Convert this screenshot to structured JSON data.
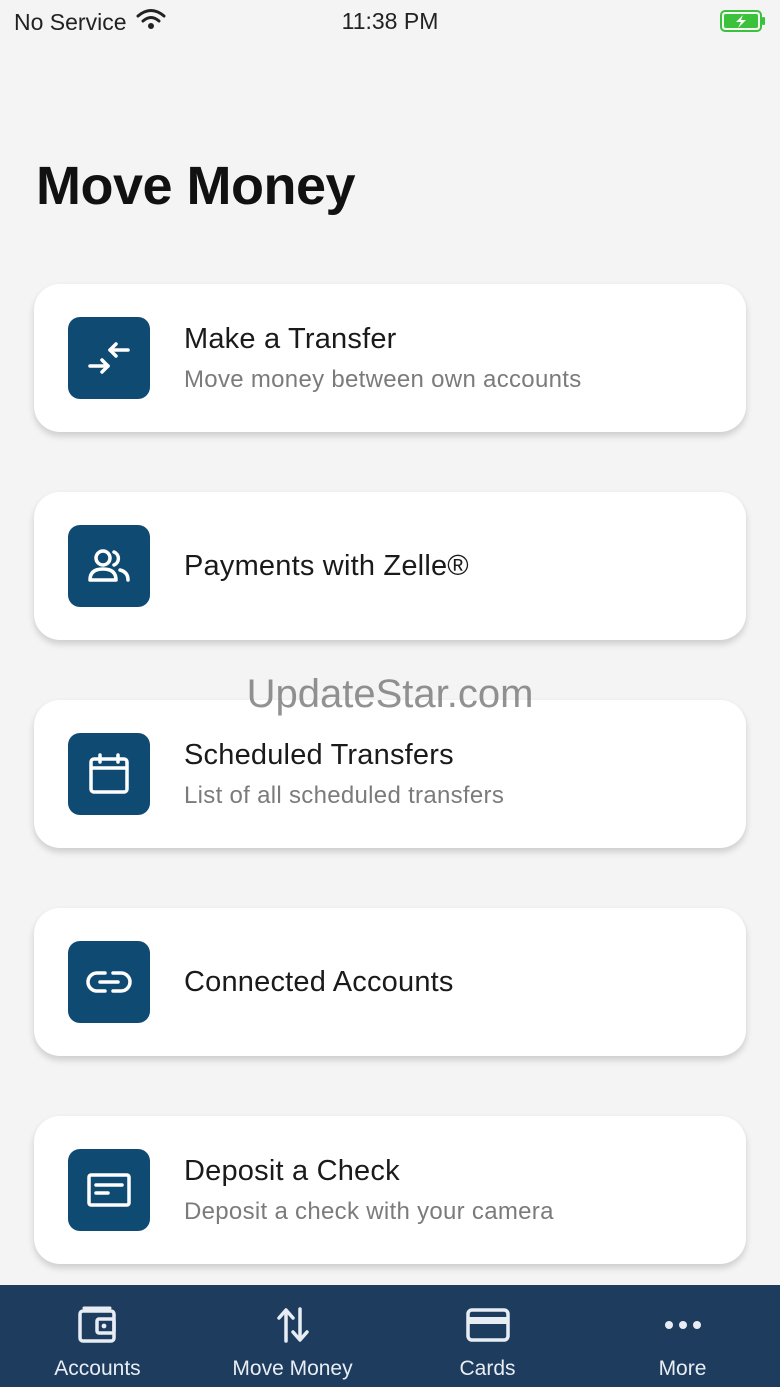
{
  "status_bar": {
    "carrier": "No Service",
    "time": "11:38 PM",
    "battery_color": "#3cc13c"
  },
  "page": {
    "title": "Move Money"
  },
  "colors": {
    "primary": "#0f4a72",
    "tab_bar": "#1d3c5e",
    "background": "#f4f4f4"
  },
  "items": [
    {
      "icon": "transfer-arrows-icon",
      "title": "Make a Transfer",
      "subtitle": "Move money between own accounts"
    },
    {
      "icon": "people-icon",
      "title": "Payments with Zelle®",
      "subtitle": ""
    },
    {
      "icon": "calendar-icon",
      "title": "Scheduled Transfers",
      "subtitle": "List of all scheduled transfers"
    },
    {
      "icon": "link-icon",
      "title": "Connected Accounts",
      "subtitle": ""
    },
    {
      "icon": "check-icon",
      "title": "Deposit a Check",
      "subtitle": "Deposit a check with your camera"
    }
  ],
  "watermark": "UpdateStar.com",
  "tabs": [
    {
      "icon": "wallet-icon",
      "label": "Accounts"
    },
    {
      "icon": "up-down-arrows-icon",
      "label": "Move Money"
    },
    {
      "icon": "card-icon",
      "label": "Cards"
    },
    {
      "icon": "more-dots-icon",
      "label": "More"
    }
  ]
}
